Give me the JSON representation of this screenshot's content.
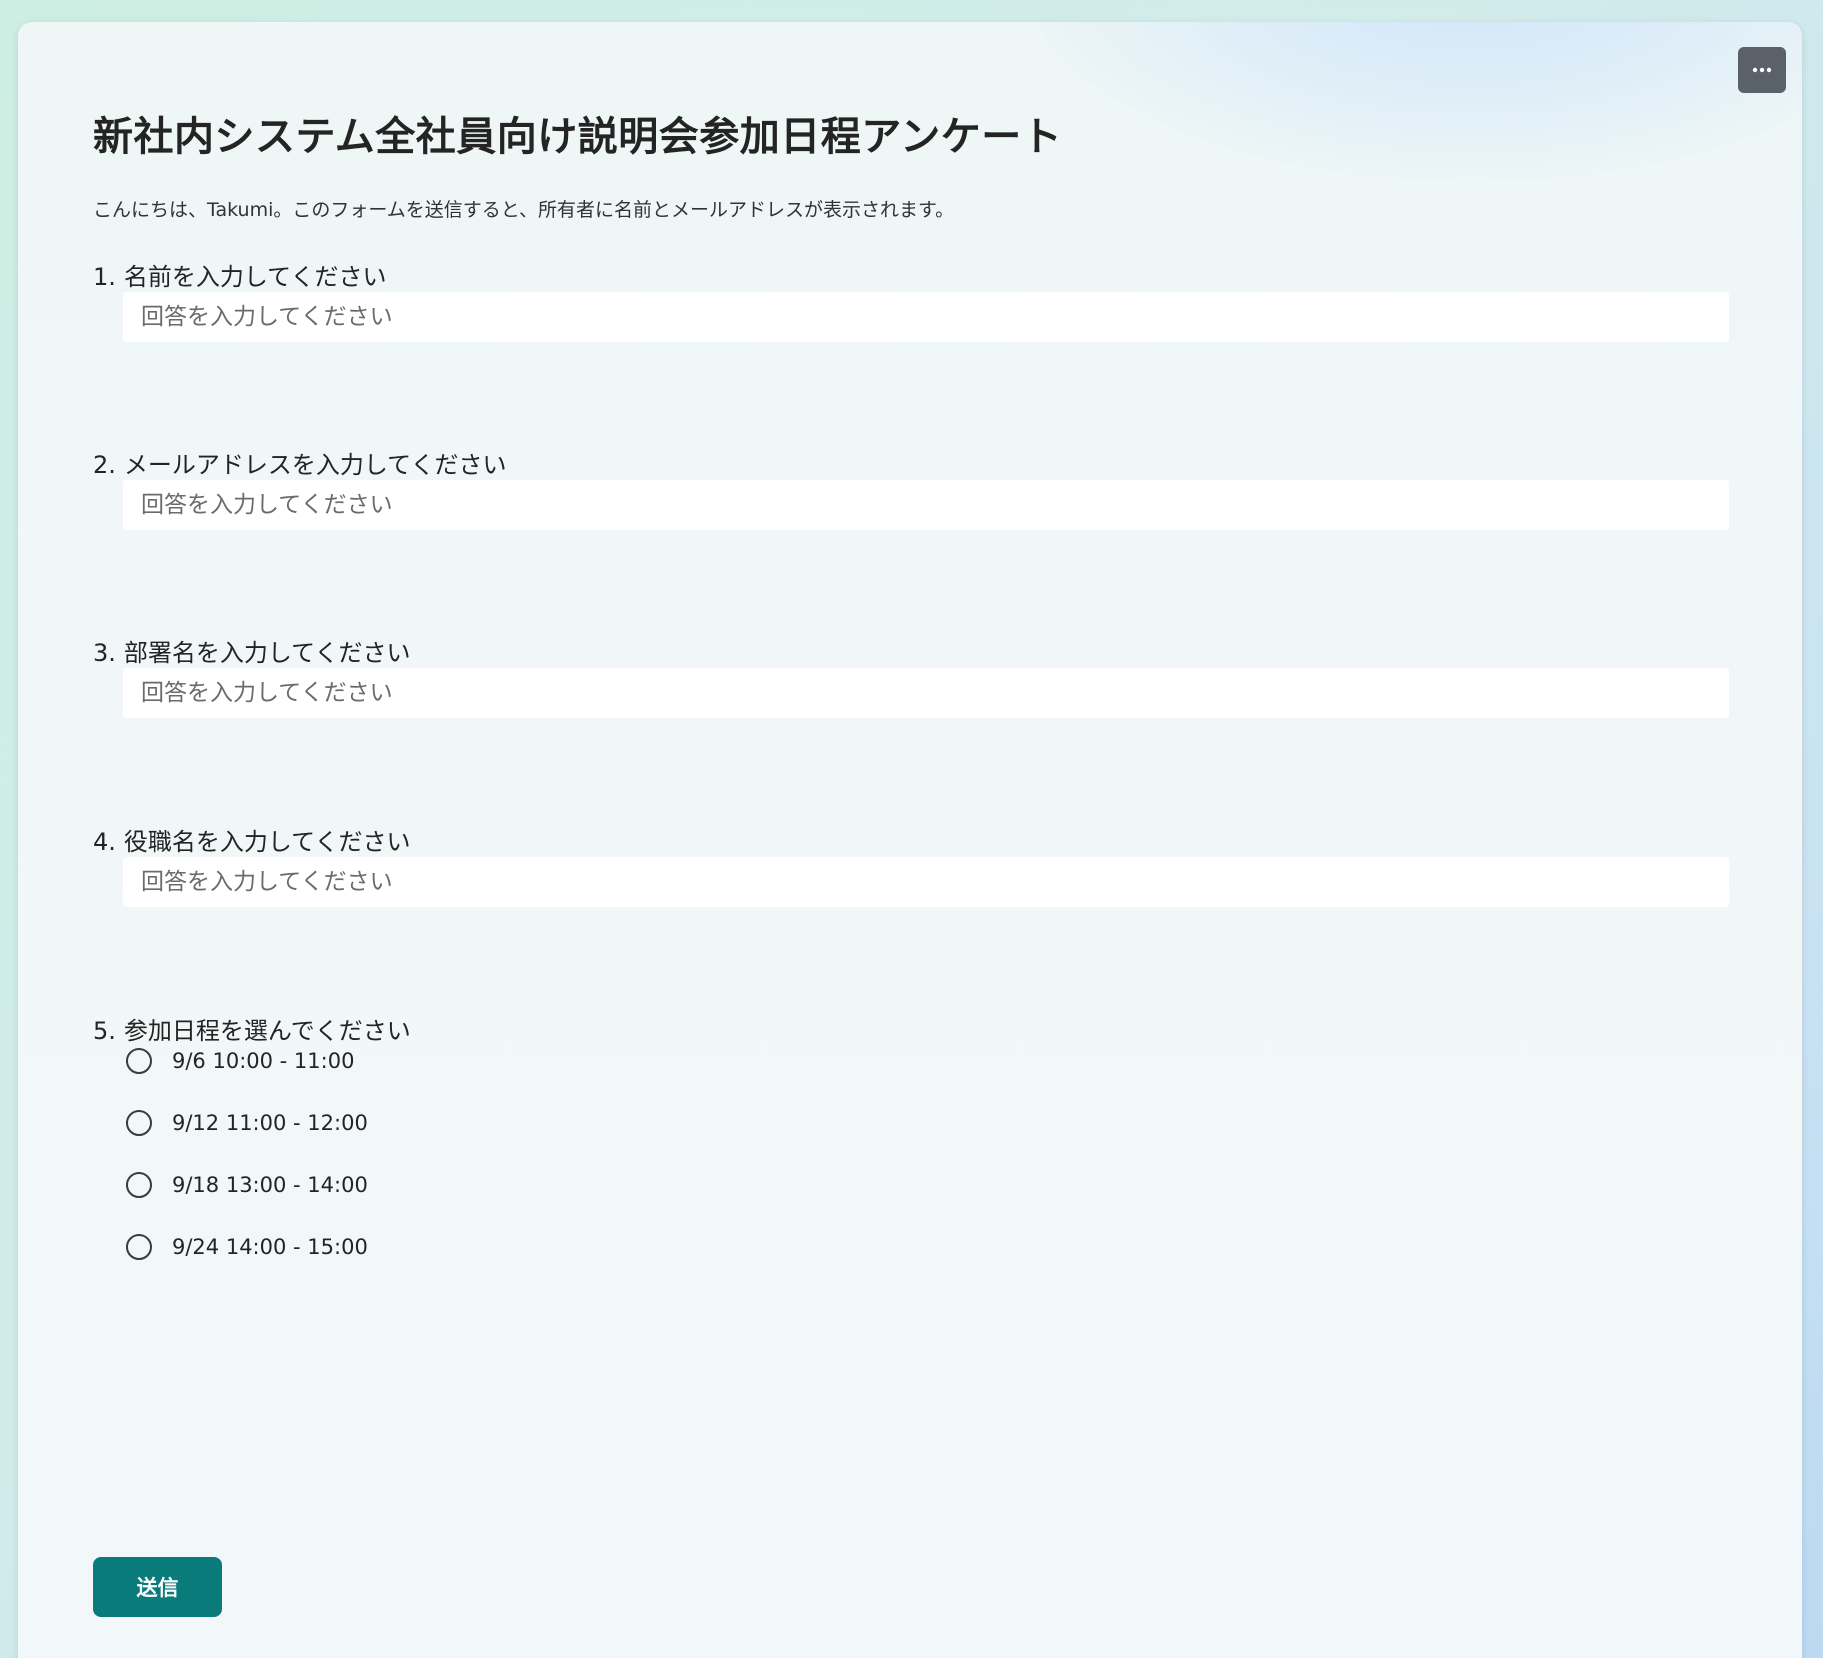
{
  "form": {
    "title": "新社内システム全社員向け説明会参加日程アンケート",
    "subtitle": "こんにちは、Takumi。このフォームを送信すると、所有者に名前とメールアドレスが表示されます。",
    "more_button_icon": "more-horizontal-icon"
  },
  "questions": [
    {
      "number": "1.",
      "label": "名前を入力してください",
      "placeholder": "回答を入力してください",
      "value": ""
    },
    {
      "number": "2.",
      "label": "メールアドレスを入力してください",
      "placeholder": "回答を入力してください",
      "value": ""
    },
    {
      "number": "3.",
      "label": "部署名を入力してください",
      "placeholder": "回答を入力してください",
      "value": ""
    },
    {
      "number": "4.",
      "label": "役職名を入力してください",
      "placeholder": "回答を入力してください",
      "value": ""
    },
    {
      "number": "5.",
      "label": "参加日程を選んでください",
      "options": [
        {
          "label": "9/6 10:00 - 11:00",
          "selected": false
        },
        {
          "label": "9/12 11:00 - 12:00",
          "selected": false
        },
        {
          "label": "9/18 13:00 - 14:00",
          "selected": false
        },
        {
          "label": "9/24 14:00 - 15:00",
          "selected": false
        }
      ]
    }
  ],
  "submit_label": "送信",
  "colors": {
    "accent": "#0a7b7b",
    "more_button_bg": "#5a6168",
    "text": "#242424"
  }
}
